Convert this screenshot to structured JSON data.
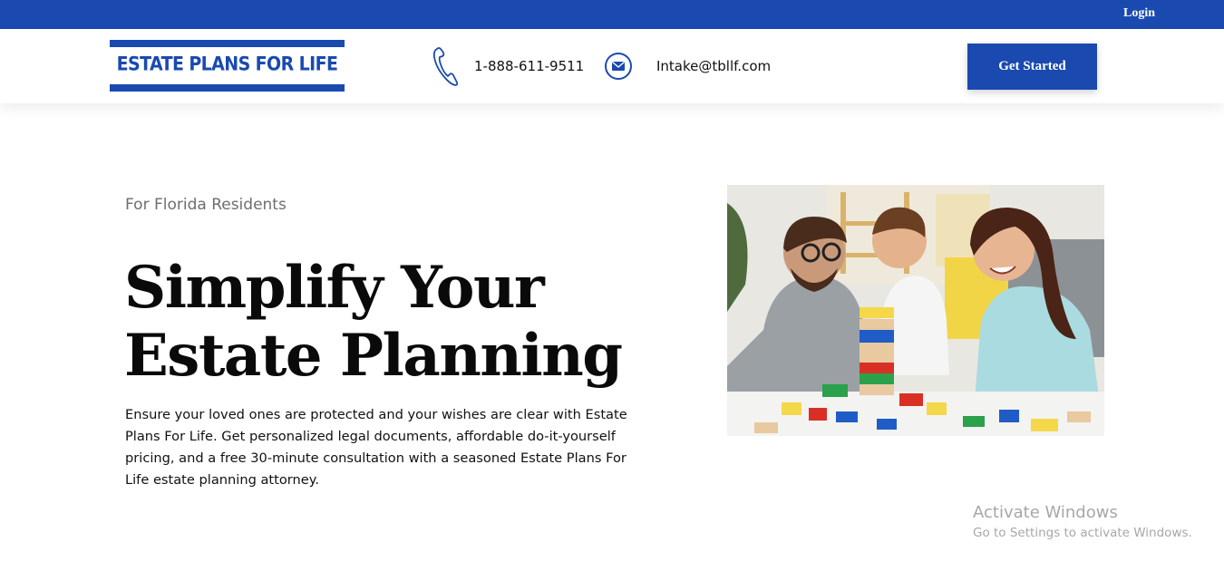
{
  "topbar": {
    "login_label": "Login"
  },
  "header": {
    "logo_text": "ESTATE PLANS FOR LIFE",
    "phone": "1-888-611-9511",
    "email": "Intake@tbllf.com",
    "cta_label": "Get Started"
  },
  "hero": {
    "eyebrow": "For Florida Residents",
    "headline_line1": "Simplify Your",
    "headline_line2": "Estate Planning",
    "body": "Ensure your loved ones are protected and your wishes are clear with Estate Plans For Life. Get personalized legal documents, affordable do-it-yourself pricing, and a free 30-minute consultation with a seasoned Estate Plans For Life estate planning attorney."
  },
  "watermark": {
    "title": "Activate Windows",
    "subtitle": "Go to Settings to activate Windows."
  },
  "icons": {
    "phone": "phone-icon",
    "email": "envelope-icon"
  },
  "colors": {
    "brand": "#1a4ab0",
    "text": "#111111",
    "muted": "#6e6e6e"
  }
}
